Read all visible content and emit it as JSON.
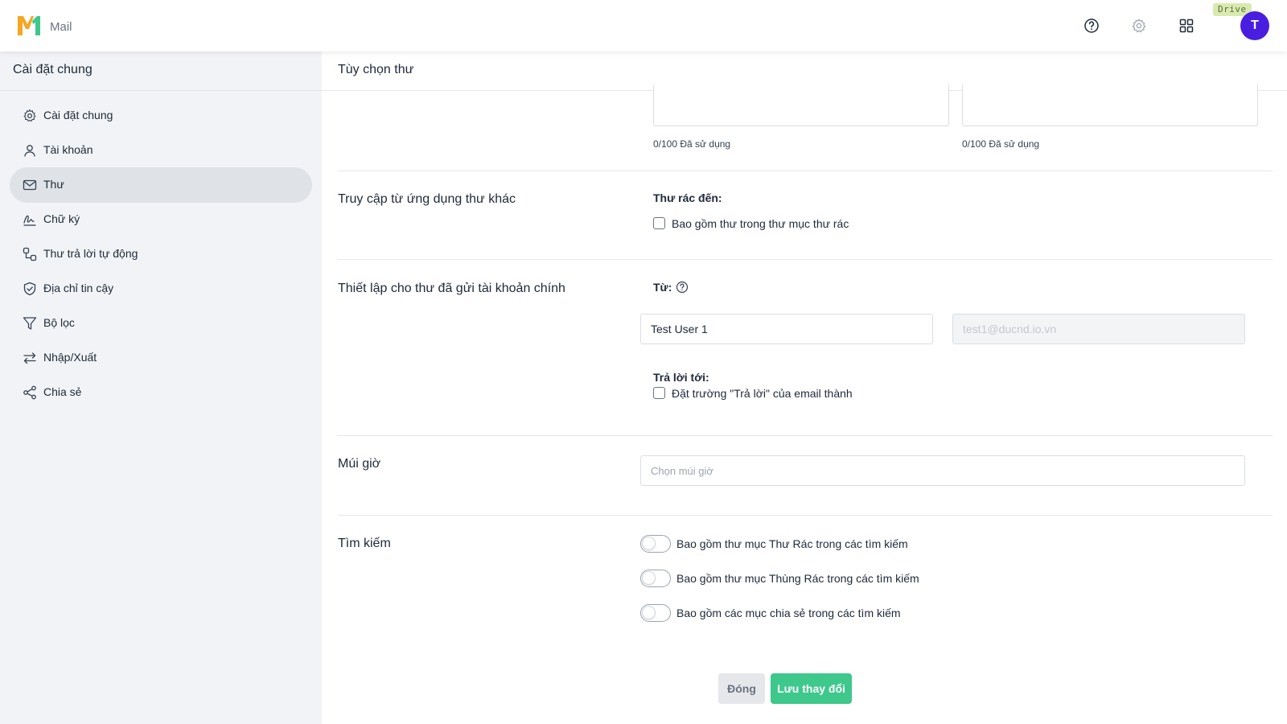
{
  "header": {
    "app_name": "Mail",
    "drive_badge": "Drive",
    "avatar_initial": "T",
    "colors": {
      "logo_orange": "#f5a623",
      "logo_green": "#3ec88c",
      "avatar": "#4a1ee0"
    }
  },
  "sidebar": {
    "title": "Cài đặt chung",
    "items": [
      {
        "label": "Cài đặt chung",
        "icon": "gear-icon"
      },
      {
        "label": "Tài khoản",
        "icon": "user-icon"
      },
      {
        "label": "Thư",
        "icon": "mail-icon",
        "active": true
      },
      {
        "label": "Chữ ký",
        "icon": "signature-icon"
      },
      {
        "label": "Thư trả lời tự động",
        "icon": "auto-reply-icon"
      },
      {
        "label": "Địa chỉ tin cậy",
        "icon": "shield-icon"
      },
      {
        "label": "Bộ lọc",
        "icon": "filter-icon"
      },
      {
        "label": "Nhập/Xuất",
        "icon": "import-export-icon"
      },
      {
        "label": "Chia sẻ",
        "icon": "share-icon"
      }
    ]
  },
  "main": {
    "title": "Tùy chọn thư",
    "usage": {
      "left": "0/100 Đã sử dụng",
      "right": "0/100 Đã sử dụng"
    },
    "access": {
      "label": "Truy cập từ ứng dụng thư khác",
      "spam_heading": "Thư rác đến:",
      "spam_checkbox": "Bao gồm thư trong thư mục thư rác"
    },
    "sent_settings": {
      "label": "Thiết lập cho thư đã gửi tài khoản chính",
      "from_label": "Từ:",
      "name_value": "Test User 1",
      "email_value": "test1@ducnd.io.vn",
      "reply_to_heading": "Trả lời tới:",
      "reply_to_checkbox": "Đặt trường \"Trả lời\" của email thành"
    },
    "timezone": {
      "label": "Múi giờ",
      "placeholder": "Chọn múi giờ"
    },
    "search": {
      "label": "Tìm kiếm",
      "toggles": [
        "Bao gồm thư mục Thư Rác trong các tìm kiếm",
        "Bao gồm thư mục Thùng Rác trong các tìm kiếm",
        "Bao gồm các mục chia sẻ trong các tìm kiếm"
      ]
    },
    "buttons": {
      "close": "Đóng",
      "save": "Lưu thay đổi"
    }
  }
}
